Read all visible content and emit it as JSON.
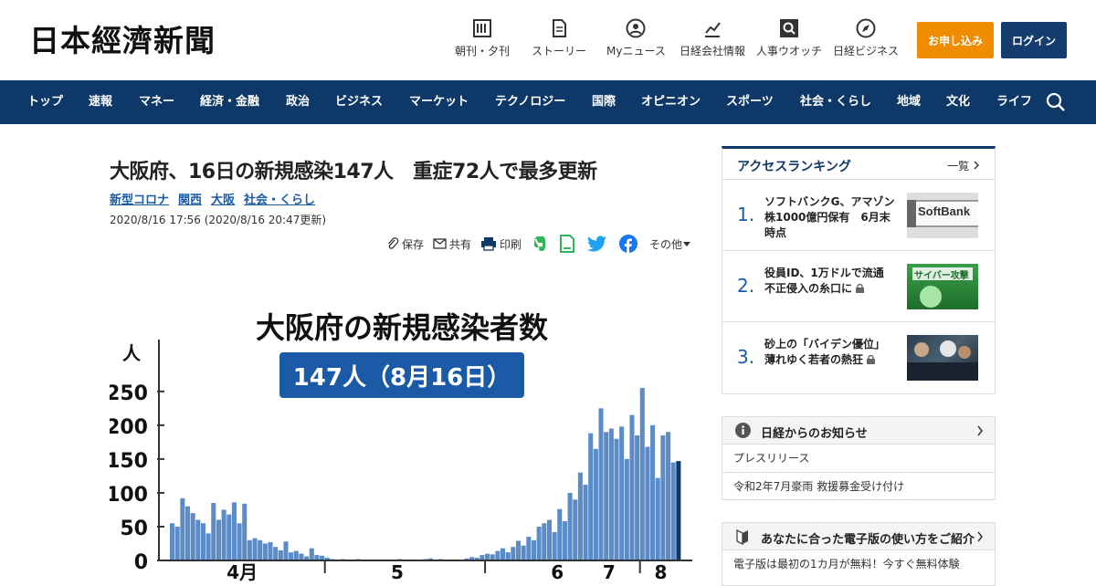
{
  "header": {
    "logo": "日本經濟新聞",
    "links": [
      {
        "label": "朝刊・夕刊",
        "icon": "newspaper-icon"
      },
      {
        "label": "ストーリー",
        "icon": "document-icon"
      },
      {
        "label": "Myニュース",
        "icon": "person-icon"
      },
      {
        "label": "日経会社情報",
        "icon": "company-chart-icon"
      },
      {
        "label": "人事ウオッチ",
        "icon": "magnifier-icon"
      },
      {
        "label": "日経ビジネス",
        "icon": "compass-icon"
      }
    ],
    "apply_label": "お申し込み",
    "login_label": "ログイン"
  },
  "nav": {
    "items": [
      "トップ",
      "速報",
      "マネー",
      "経済・金融",
      "政治",
      "ビジネス",
      "マーケット",
      "テクノロジー",
      "国際",
      "オピニオン",
      "スポーツ",
      "社会・くらし",
      "地域",
      "文化",
      "ライフ"
    ]
  },
  "article": {
    "headline": "大阪府、16日の新規感染147人　重症72人で最多更新",
    "tags": [
      "新型コロナ",
      "関西",
      "大阪",
      "社会・くらし"
    ],
    "dateline": "2020/8/16 17:56 (2020/8/16 20:47更新)",
    "share": {
      "save": "保存",
      "share": "共有",
      "print": "印刷",
      "more": "その他"
    }
  },
  "chart_data": {
    "type": "bar",
    "title": "大阪府の新規感染者数",
    "badge": "147人（8月16日）",
    "ylabel": "人",
    "ylim": [
      0,
      270
    ],
    "yticks": [
      "0",
      "50",
      "100",
      "150",
      "200",
      "250"
    ],
    "month_labels": [
      "4月",
      "5",
      "6",
      "7",
      "8"
    ],
    "values": [
      55,
      50,
      92,
      80,
      70,
      60,
      55,
      40,
      85,
      60,
      75,
      68,
      86,
      55,
      84,
      30,
      33,
      30,
      25,
      27,
      20,
      15,
      28,
      12,
      14,
      10,
      6,
      18,
      8,
      7,
      4,
      2,
      1,
      2,
      1,
      0,
      2,
      1,
      0,
      0,
      0,
      0,
      1,
      0,
      2,
      1,
      0,
      0,
      0,
      2,
      3,
      1,
      2,
      0,
      1,
      0,
      1,
      3,
      5,
      4,
      8,
      10,
      9,
      14,
      18,
      12,
      20,
      29,
      22,
      35,
      30,
      50,
      55,
      60,
      42,
      76,
      58,
      100,
      90,
      130,
      112,
      188,
      165,
      225,
      190,
      195,
      180,
      198,
      150,
      215,
      185,
      255,
      168,
      200,
      122,
      185,
      190,
      145,
      147
    ],
    "colors": {
      "bar": "#5b8cc8",
      "last_bar": "#0d3868",
      "badge": "#1a5aa6"
    }
  },
  "sidebar": {
    "ranking": {
      "title": "アクセスランキング",
      "more": "一覧",
      "items": [
        {
          "num": "1.",
          "text": "ソフトバンクG、アマゾン株1000億円保有　6月末時点",
          "thumb_text": "SoftBank",
          "locked": false
        },
        {
          "num": "2.",
          "text": "役員ID、1万ドルで流通　不正侵入の糸口に",
          "thumb_text": "サイバー攻撃",
          "locked": true
        },
        {
          "num": "3.",
          "text": "砂上の「バイデン優位」　薄れゆく若者の熱狂",
          "thumb_text": "",
          "locked": true
        }
      ]
    },
    "notice": {
      "title": "日経からのお知らせ",
      "items": [
        "プレスリリース",
        "令和2年7月豪雨 救援募金受け付け"
      ]
    },
    "guide": {
      "title": "あなたに合った電子版の使い方をご紹介",
      "items": [
        "電子版は最初の1カ月が無料！今すぐ無料体験"
      ]
    }
  }
}
